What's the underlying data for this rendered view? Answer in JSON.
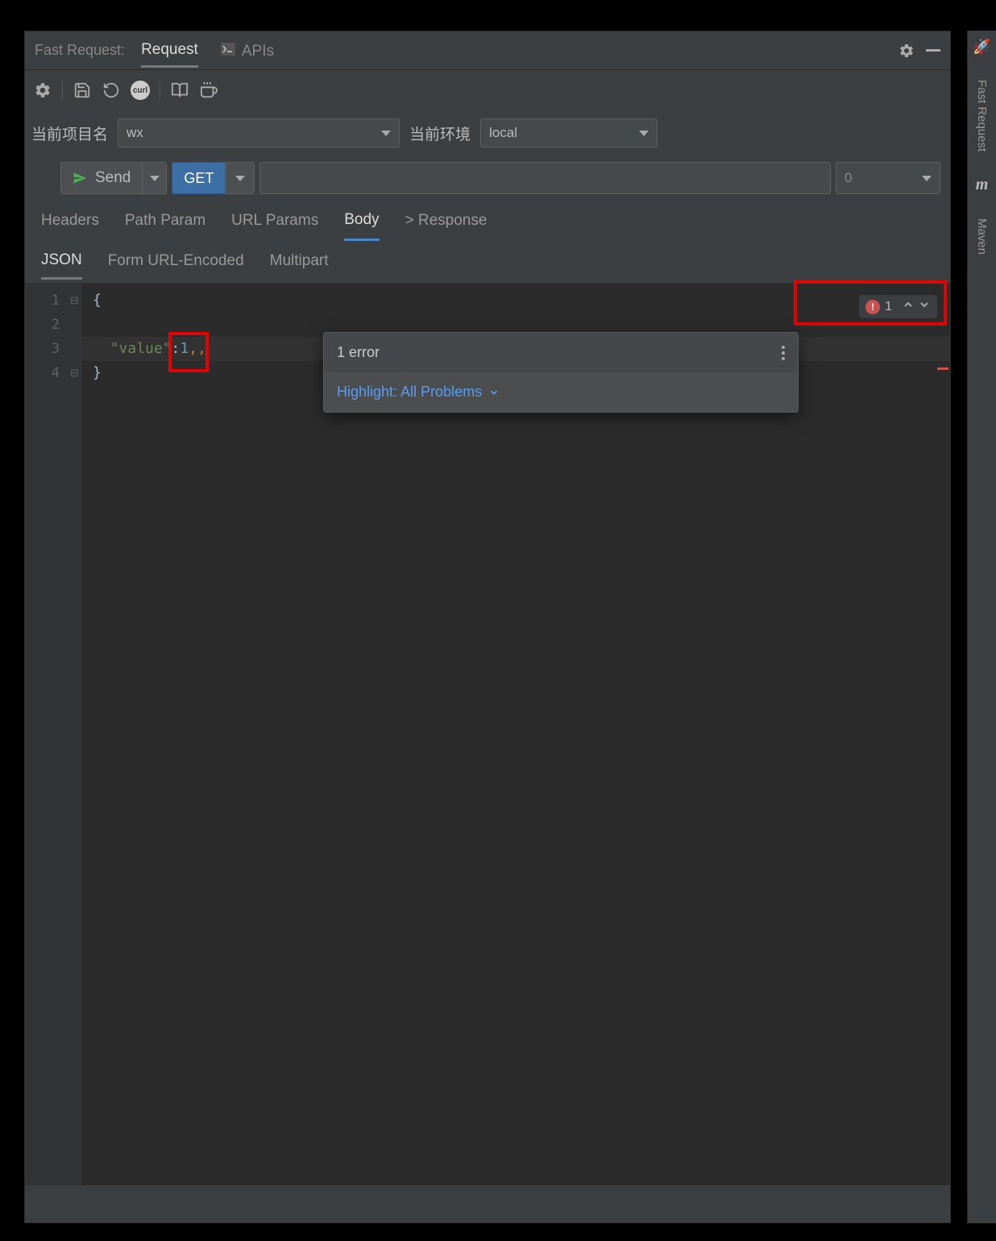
{
  "window_title": "Fast Request:",
  "top_tabs": {
    "request": "Request",
    "apis": "APIs"
  },
  "project": {
    "label": "当前项目名",
    "value": "wx"
  },
  "env": {
    "label": "当前环境",
    "value": "local"
  },
  "send": {
    "label": "Send",
    "method": "GET",
    "status_code": "0"
  },
  "main_tabs": {
    "headers": "Headers",
    "path_param": "Path Param",
    "url_params": "URL Params",
    "body": "Body",
    "response": "> Response"
  },
  "sub_tabs": {
    "json": "JSON",
    "form": "Form URL-Encoded",
    "multipart": "Multipart"
  },
  "editor": {
    "lines": [
      "1",
      "2",
      "3",
      "4"
    ],
    "line1": "{",
    "line3_key": "\"value\"",
    "line3_sep": ":",
    "line3_val": "1",
    "line3_err": ",,",
    "line4": "}"
  },
  "error_badge": {
    "count": "1"
  },
  "tooltip": {
    "title": "1 error",
    "highlight": "Highlight: All Problems"
  },
  "sidebar": {
    "fast_request": "Fast Request",
    "maven": "Maven",
    "maven_icon": "m"
  }
}
